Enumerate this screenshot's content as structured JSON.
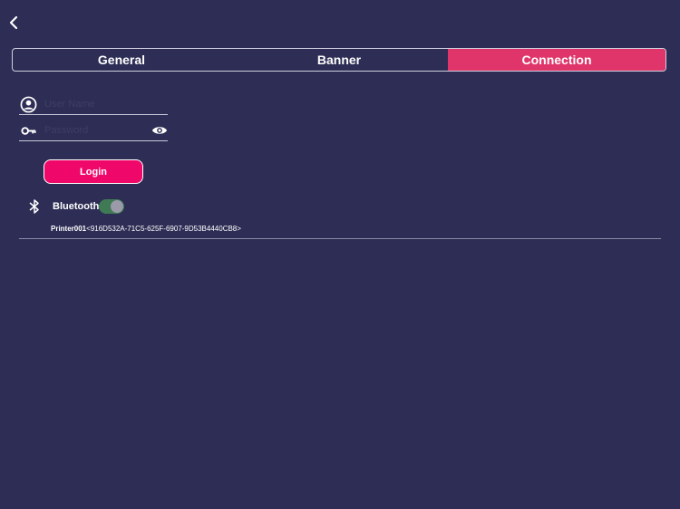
{
  "nav": {
    "back_icon": "chevron-left-icon"
  },
  "tabs": [
    {
      "label": "General",
      "active": false
    },
    {
      "label": "Banner",
      "active": false
    },
    {
      "label": "Connection",
      "active": true
    }
  ],
  "login_form": {
    "username_placeholder": "User Name",
    "username_value": "",
    "username_icon": "account-circle-icon",
    "password_placeholder": "Password",
    "password_value": "",
    "password_icon": "key-icon",
    "reveal_icon": "eye-icon",
    "login_label": "Login"
  },
  "bluetooth": {
    "icon": "bluetooth-icon",
    "label": "Bluetooth",
    "enabled": true
  },
  "device": {
    "name": "Printer001",
    "uuid": "<916D532A-71C5-625F-6907-9D53B4440CB8>"
  },
  "colors": {
    "background": "#2d2d55",
    "accent": "#e0356a",
    "button": "#f0076a",
    "toggle_track": "#3f7a55"
  }
}
